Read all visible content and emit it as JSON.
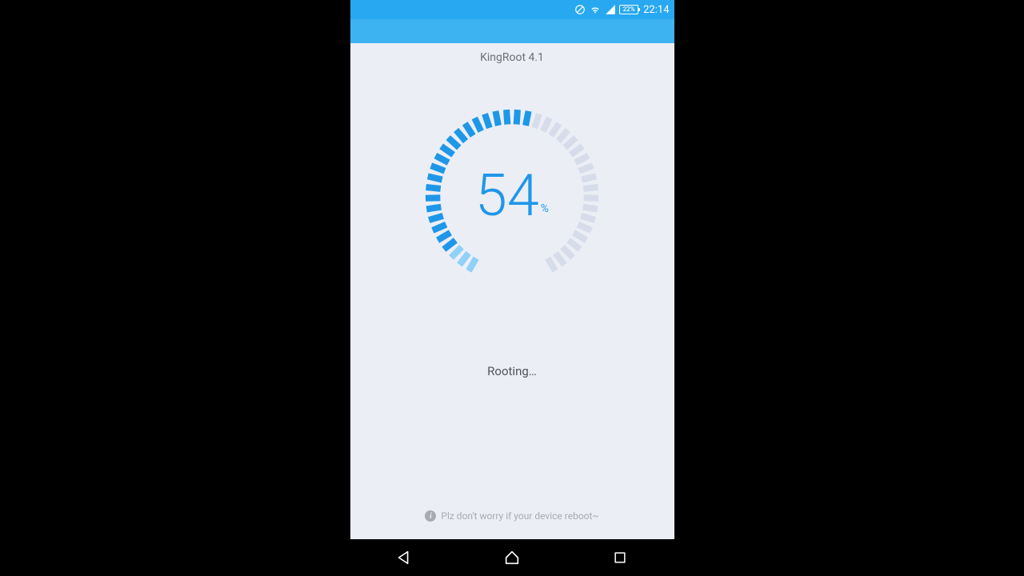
{
  "statusbar": {
    "battery_pct": "22%",
    "time": "22:14"
  },
  "app": {
    "title": "KingRoot 4.1",
    "progress_value": "54",
    "progress_unit": "%",
    "progress_percent_num": 54,
    "status_text": "Rooting…",
    "hint_text": "Plz don't worry if your device reboot~"
  },
  "colors": {
    "statusbar_bg": "#28a8f0",
    "header_bg": "#3db3f2",
    "app_bg": "#eceef6",
    "accent": "#1f97e8",
    "tick_inactive": "#d7dceb",
    "tick_active_light": "#8fd1f7",
    "text_muted": "#a7aab3"
  }
}
